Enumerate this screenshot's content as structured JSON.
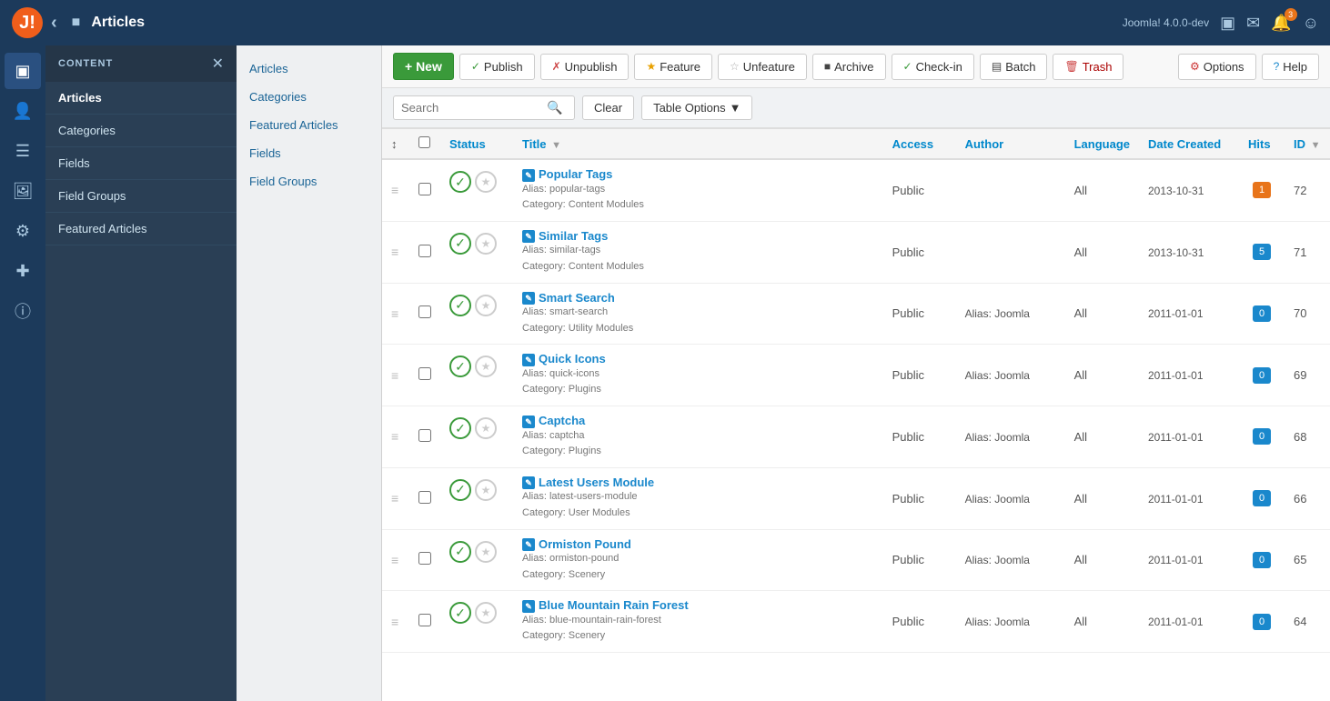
{
  "app": {
    "version": "Joomla! 4.0.0-dev",
    "page_title": "Articles"
  },
  "toolbar": {
    "new_label": "+ New",
    "publish_label": "Publish",
    "unpublish_label": "Unpublish",
    "feature_label": "Feature",
    "unfeature_label": "Unfeature",
    "archive_label": "Archive",
    "checkin_label": "Check-in",
    "batch_label": "Batch",
    "trash_label": "Trash",
    "options_label": "Options",
    "help_label": "Help"
  },
  "search": {
    "placeholder": "Search",
    "clear_label": "Clear",
    "table_options_label": "Table Options"
  },
  "table": {
    "columns": {
      "status": "Status",
      "title": "Title",
      "access": "Access",
      "author": "Author",
      "language": "Language",
      "date_created": "Date Created",
      "hits": "Hits",
      "id": "ID"
    },
    "rows": [
      {
        "title": "Popular Tags",
        "alias": "popular-tags",
        "category": "Content Modules",
        "access": "Public",
        "author": "",
        "language": "All",
        "date_created": "2013-10-31",
        "hits": 1,
        "hits_color": "orange",
        "id": 72
      },
      {
        "title": "Similar Tags",
        "alias": "similar-tags",
        "category": "Content Modules",
        "access": "Public",
        "author": "",
        "language": "All",
        "date_created": "2013-10-31",
        "hits": 5,
        "hits_color": "blue",
        "id": 71
      },
      {
        "title": "Smart Search",
        "alias": "smart-search",
        "category": "Utility Modules",
        "access": "Public",
        "author": "Alias: Joomla",
        "language": "All",
        "date_created": "2011-01-01",
        "hits": 0,
        "hits_color": "blue",
        "id": 70
      },
      {
        "title": "Quick Icons",
        "alias": "quick-icons",
        "category": "Plugins",
        "access": "Public",
        "author": "Alias: Joomla",
        "language": "All",
        "date_created": "2011-01-01",
        "hits": 0,
        "hits_color": "blue",
        "id": 69
      },
      {
        "title": "Captcha",
        "alias": "captcha",
        "category": "Plugins",
        "access": "Public",
        "author": "Alias: Joomla",
        "language": "All",
        "date_created": "2011-01-01",
        "hits": 0,
        "hits_color": "blue",
        "id": 68
      },
      {
        "title": "Latest Users Module",
        "alias": "latest-users-module",
        "category": "User Modules",
        "access": "Public",
        "author": "Alias: Joomla",
        "language": "All",
        "date_created": "2011-01-01",
        "hits": 0,
        "hits_color": "blue",
        "id": 66
      },
      {
        "title": "Ormiston Pound",
        "alias": "ormiston-pound",
        "category": "Scenery",
        "access": "Public",
        "author": "Alias: Joomla",
        "language": "All",
        "date_created": "2011-01-01",
        "hits": 0,
        "hits_color": "blue",
        "id": 65
      },
      {
        "title": "Blue Mountain Rain Forest",
        "alias": "blue-mountain-rain-forest",
        "category": "Scenery",
        "access": "Public",
        "author": "Alias: Joomla",
        "language": "All",
        "date_created": "2011-01-01",
        "hits": 0,
        "hits_color": "blue",
        "id": 64
      }
    ]
  },
  "sidebar": {
    "header": "CONTENT",
    "items": [
      "Articles",
      "Categories",
      "Fields",
      "Field Groups",
      "Featured Articles"
    ],
    "active": "Articles"
  },
  "sub_sidebar": {
    "items": [
      "Articles",
      "Categories",
      "Featured Articles",
      "Fields",
      "Field Groups"
    ]
  },
  "left_icons": [
    "grid-icon",
    "user-icon",
    "menu-icon",
    "media-icon",
    "module-icon",
    "plugin-icon",
    "info-icon"
  ]
}
